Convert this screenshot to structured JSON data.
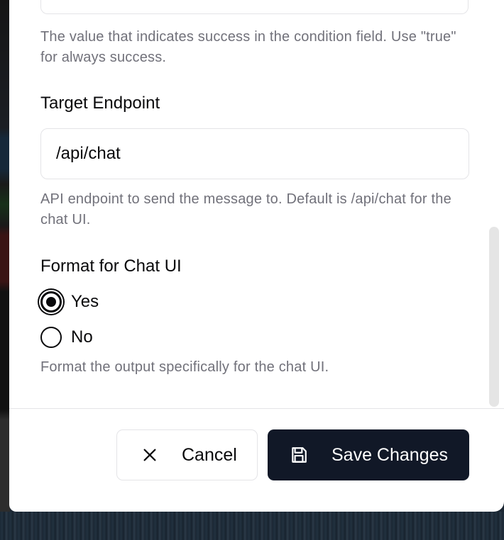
{
  "condition_value": {
    "help": "The value that indicates success in the condition field. Use \"true\" for always success."
  },
  "target_endpoint": {
    "label": "Target Endpoint",
    "value": "/api/chat",
    "help": "API endpoint to send the message to. Default is /api/chat for the chat UI."
  },
  "format_chat_ui": {
    "label": "Format for Chat UI",
    "options": [
      {
        "label": "Yes",
        "checked": true
      },
      {
        "label": "No",
        "checked": false
      }
    ],
    "help": "Format the output specifically for the chat UI."
  },
  "footer": {
    "cancel_label": "Cancel",
    "save_label": "Save Changes",
    "cancel_icon": "x-icon",
    "save_icon": "save-icon"
  },
  "colors": {
    "primary": "#111827",
    "text": "#09090b",
    "muted": "#71717a",
    "border": "#e4e4e7"
  }
}
